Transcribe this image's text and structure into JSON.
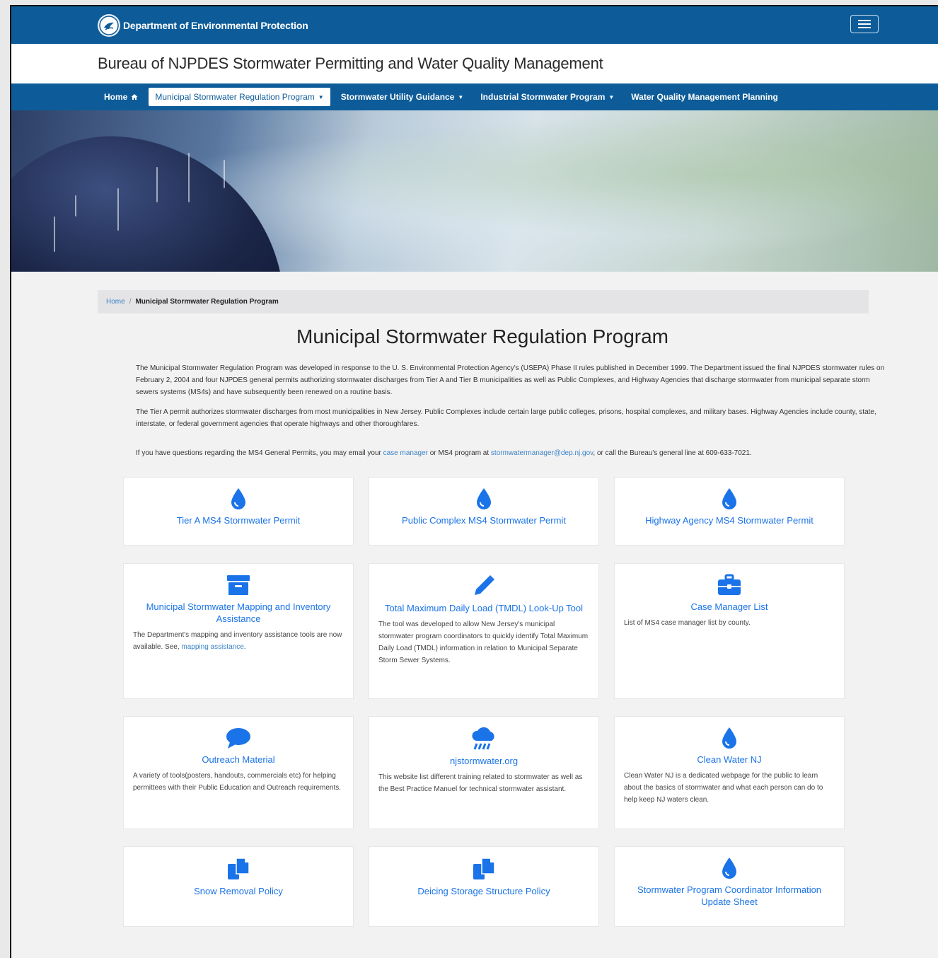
{
  "header": {
    "department": "Department of Environmental Protection",
    "bureau_title": "Bureau of NJPDES Stormwater Permitting and Water Quality Management"
  },
  "nav": {
    "items": [
      {
        "label": "Home"
      },
      {
        "label": "Municipal Stormwater Regulation Program"
      },
      {
        "label": "Stormwater Utility Guidance"
      },
      {
        "label": "Industrial Stormwater Program"
      },
      {
        "label": "Water Quality Management Planning"
      }
    ]
  },
  "breadcrumb": {
    "home": "Home",
    "separator": "/",
    "current": "Municipal Stormwater Regulation Program"
  },
  "page_title": "Municipal Stormwater Regulation Program",
  "intro": {
    "p1": "The Municipal Stormwater Regulation Program was developed in response to the U. S. Environmental Protection Agency's (USEPA) Phase II rules published in December 1999.  The Department issued the final NJPDES stormwater rules on February 2, 2004 and four NJPDES general permits authorizing stormwater discharges from Tier A and Tier B municipalities as well as Public Complexes, and Highway Agencies that discharge stormwater from municipal separate storm sewers systems (MS4s) and have subsequently been renewed on a routine basis.",
    "p2": "The Tier A permit authorizes stormwater discharges from most municipalities in New Jersey. Public Complexes include certain large public colleges, prisons, hospital complexes, and military bases.  Highway Agencies include county, state, interstate, or federal government agencies that operate highways and other thoroughfares.",
    "p3_a": "If you have questions regarding the MS4 General Permits, you may email your ",
    "p3_link1": "case manager",
    "p3_b": " or MS4 program at ",
    "p3_link2": "stormwatermanager@dep.nj.gov",
    "p3_c": ", or call the Bureau's general line at 609-633-7021."
  },
  "cards": [
    {
      "title": "Tier A MS4 Stormwater Permit",
      "icon": "water-drop-icon"
    },
    {
      "title": "Public Complex MS4 Stormwater Permit",
      "icon": "water-drop-icon"
    },
    {
      "title": "Highway Agency MS4 Stormwater Permit",
      "icon": "water-drop-icon"
    },
    {
      "title": "Municipal Stormwater Mapping and Inventory Assistance",
      "icon": "archive-icon",
      "desc": "The Department's mapping and inventory assistance tools are now available. See, ",
      "desc_link": "mapping assistance",
      "desc_end": "."
    },
    {
      "title": "Total Maximum Daily Load (TMDL) Look-Up Tool",
      "icon": "pencil-icon",
      "desc": "The tool was developed to allow New Jersey's municipal stormwater program coordinators to quickly identify Total Maximum Daily Load (TMDL) information in relation to Municipal Separate Storm Sewer Systems."
    },
    {
      "title": "Case Manager List",
      "icon": "briefcase-icon",
      "desc": "List of MS4 case manager list by county."
    },
    {
      "title": "Outreach Material",
      "icon": "speech-bubble-icon",
      "desc": "A variety of tools(posters, handouts, commercials etc) for helping permittees with their Public Education and Outreach requirements."
    },
    {
      "title": "njstormwater.org",
      "icon": "cloud-rain-icon",
      "desc": "This website list different training related to stormwater as well as the Best Practice Manuel for technical stormwater assistant."
    },
    {
      "title": "Clean Water NJ",
      "icon": "water-drop-icon",
      "desc": "Clean Water NJ is a dedicated webpage for the public to learn about the basics of stormwater and what each person can do to help keep NJ waters clean."
    },
    {
      "title": "Snow Removal Policy",
      "icon": "copy-icon"
    },
    {
      "title": "Deicing Storage Structure Policy",
      "icon": "copy-icon"
    },
    {
      "title": "Stormwater Program Coordinator Information Update Sheet",
      "icon": "water-drop-icon"
    }
  ],
  "colors": {
    "brand": "#0d5c99",
    "link": "#1a73e8",
    "icon": "#1a73e8"
  }
}
